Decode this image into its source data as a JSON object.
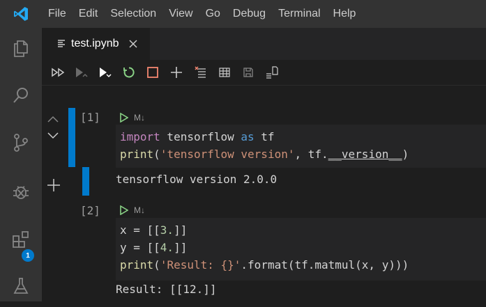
{
  "menubar": {
    "items": [
      "File",
      "Edit",
      "Selection",
      "View",
      "Go",
      "Debug",
      "Terminal",
      "Help"
    ]
  },
  "activitybar": {
    "icons": [
      "explorer-icon",
      "search-icon",
      "source-control-icon",
      "debug-icon",
      "extensions-icon",
      "flask-icon"
    ],
    "extensions_badge": "1"
  },
  "tab": {
    "title": "test.ipynb",
    "icon": "file-lines-icon"
  },
  "toolbar": {
    "icons": [
      "run-all-icon",
      "run-above-icon",
      "run-below-icon",
      "restart-kernel-icon",
      "interrupt-icon",
      "add-cell-icon",
      "clear-outputs-icon",
      "variables-icon",
      "save-icon",
      "export-icon"
    ]
  },
  "notebook": {
    "cells": [
      {
        "exec_count": "[1]",
        "md_toggle": "M↓",
        "code": [
          [
            [
              "import",
              "kw"
            ],
            [
              " tensorflow ",
              ""
            ],
            [
              "as",
              "kw2"
            ],
            [
              " tf",
              ""
            ]
          ],
          [
            [
              "print",
              "fn"
            ],
            [
              "(",
              ""
            ],
            [
              "'tensorflow version'",
              "str"
            ],
            [
              ", tf.",
              ""
            ],
            [
              "__version__",
              "ul"
            ],
            [
              ")",
              ""
            ]
          ]
        ],
        "output": "tensorflow version 2.0.0"
      },
      {
        "exec_count": "[2]",
        "md_toggle": "M↓",
        "code": [
          [
            [
              "x = [[",
              ""
            ],
            [
              "3.",
              "num"
            ],
            [
              "]]",
              ""
            ]
          ],
          [
            [
              "y = [[",
              ""
            ],
            [
              "4.",
              "num"
            ],
            [
              "]]",
              ""
            ]
          ],
          [
            [
              "print",
              "fn"
            ],
            [
              "(",
              ""
            ],
            [
              "'Result: {}'",
              "str"
            ],
            [
              ".format(tf.matmul(x, y)))",
              ""
            ]
          ]
        ],
        "output": "Result: [[12.]]"
      }
    ]
  },
  "colors": {
    "accent": "#007acc",
    "run_green": "#89d185",
    "interrupt": "#f48771",
    "editor_bg": "#1e1e1e",
    "cell_bg": "#252526"
  }
}
